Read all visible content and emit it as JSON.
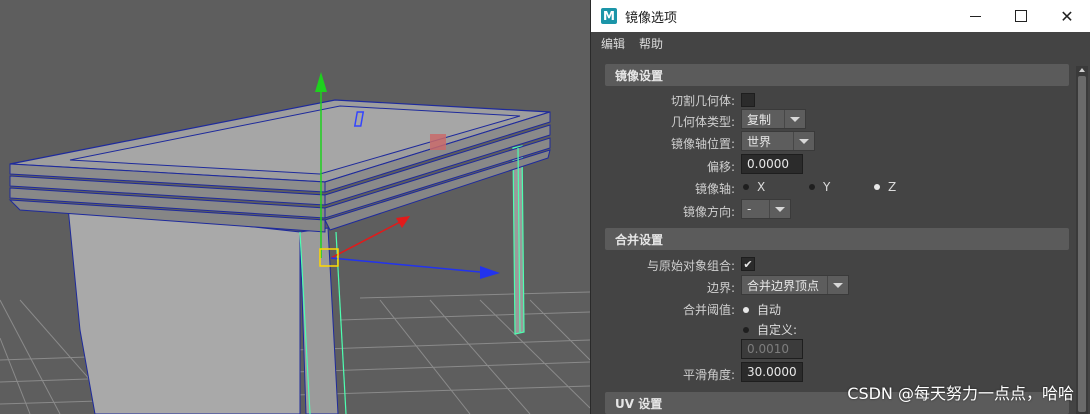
{
  "dialog": {
    "logo_letter": "M",
    "title": "镜像选项",
    "menu": [
      "编辑",
      "帮助"
    ]
  },
  "mirror_settings": {
    "header": "镜像设置",
    "cut_geometry": {
      "label": "切割几何体:",
      "checked": false
    },
    "geometry_type": {
      "label": "几何体类型:",
      "value": "复制"
    },
    "mirror_axis_position": {
      "label": "镜像轴位置:",
      "value": "世界"
    },
    "offset": {
      "label": "偏移:",
      "value": "0.0000"
    },
    "mirror_axis": {
      "label": "镜像轴:",
      "options": [
        {
          "label": "X",
          "selected": false
        },
        {
          "label": "Y",
          "selected": false
        },
        {
          "label": "Z",
          "selected": true
        }
      ]
    },
    "mirror_direction": {
      "label": "镜像方向:",
      "value": "-"
    }
  },
  "merge_settings": {
    "header": "合并设置",
    "combine_with_original": {
      "label": "与原始对象组合:",
      "check_mark": "✔",
      "checked": true
    },
    "border": {
      "label": "边界:",
      "value": "合并边界顶点"
    },
    "merge_threshold": {
      "label": "合并阈值:",
      "options": [
        {
          "label": "自动",
          "selected": true
        },
        {
          "label": "自定义:",
          "selected": false
        }
      ],
      "custom_value": "0.0010"
    },
    "smoothing_angle": {
      "label": "平滑角度:",
      "value": "30.0000"
    }
  },
  "uv_settings": {
    "header": "UV 设置"
  },
  "watermark": "CSDN @每天努力一点点，哈哈",
  "colors": {
    "viewport_bg": "#5e5e5e",
    "dialog_bg": "#444444",
    "section_header_bg": "#5b5b5b",
    "selection_wire": "#1e2a9c",
    "pivot_green": "#00ff44",
    "axis_x": "#e21a1a",
    "axis_y": "#1ed11e",
    "axis_z": "#2233ee",
    "highlight_edge": "#4dffb0",
    "pivot_box": "#ffd800"
  },
  "icons": {
    "minimize": "minimize-icon",
    "maximize": "maximize-icon",
    "close": "close-icon",
    "dropdown": "chevron-down-icon"
  }
}
